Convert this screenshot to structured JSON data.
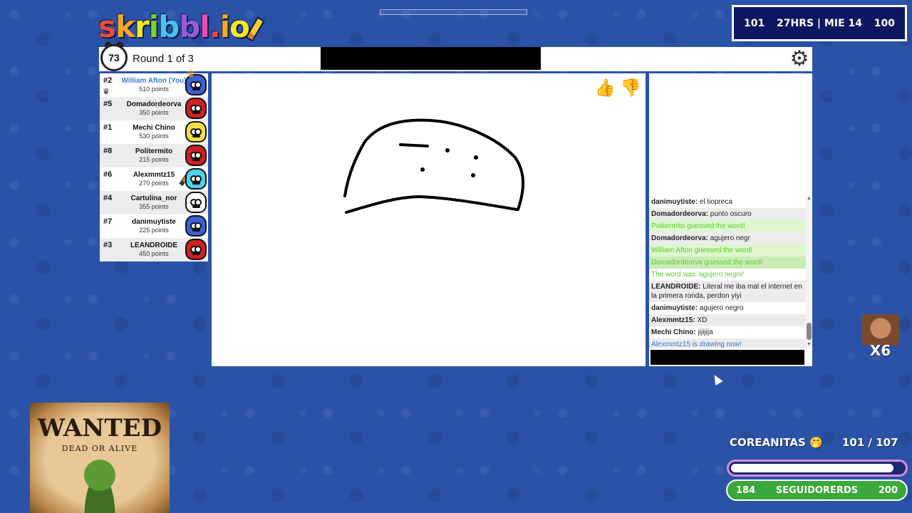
{
  "app": {
    "logo_text_1": "skribbl",
    "logo_text_2": ".io"
  },
  "colors": {
    "background": "#2a53a7",
    "guess_green": "#56ce27",
    "draw_blue": "#3975ce",
    "self_name_blue": "#3a7cd8"
  },
  "stream": {
    "left_value": "101",
    "center_text": "27HRS | MIE 14",
    "right_value": "100"
  },
  "header": {
    "timer": "73",
    "round_label": "Round 1 of 3",
    "settings_icon": "gear-icon"
  },
  "players": [
    {
      "rank": "#2",
      "name": "William Afton (You)",
      "points": "510 points",
      "color": "#3d5fd8",
      "self": true,
      "crown": true
    },
    {
      "rank": "#5",
      "name": "Domadordeorva",
      "points": "350 points",
      "color": "#d02020"
    },
    {
      "rank": "#1",
      "name": "Mechi Chino",
      "points": "530 points",
      "color": "#f5e048"
    },
    {
      "rank": "#8",
      "name": "Politermito",
      "points": "215 points",
      "color": "#d02020"
    },
    {
      "rank": "#6",
      "name": "Alexmmtz15",
      "points": "270 points",
      "color": "#4fd0e8",
      "drawing": true
    },
    {
      "rank": "#4",
      "name": "Cartulina_nor",
      "points": "355 points",
      "color": "#ffffff"
    },
    {
      "rank": "#7",
      "name": "danimuytiste",
      "points": "225 points",
      "color": "#3d5fd8"
    },
    {
      "rank": "#3",
      "name": "LEANDROIDE",
      "points": "450 points",
      "color": "#d02020"
    }
  ],
  "canvas": {
    "like_icon": "thumbs-up-icon",
    "dislike_icon": "thumbs-down-icon"
  },
  "chat": {
    "messages": [
      {
        "who": "danimuytiste",
        "text": "el tiopreca",
        "type": "normal"
      },
      {
        "who": "Domadordeorva",
        "text": "punto oscuro",
        "type": "normal"
      },
      {
        "who": "",
        "text": "Politermito guessed the word!",
        "type": "guess"
      },
      {
        "who": "Domadordeorva",
        "text": "agujero negr",
        "type": "normal"
      },
      {
        "who": "",
        "text": "William Afton guessed the word!",
        "type": "guess"
      },
      {
        "who": "",
        "text": "Domadordeorva guessed the word!",
        "type": "guess"
      },
      {
        "who": "",
        "text": "The word was 'agujero negro'",
        "type": "info"
      },
      {
        "who": "LEANDROIDE",
        "text": "Literal me iba mal el internet en la primera ronda, perdon yiyi",
        "type": "normal"
      },
      {
        "who": "danimuytiste",
        "text": "agujero negro",
        "type": "normal"
      },
      {
        "who": "Alexmmtz15",
        "text": "XD",
        "type": "normal"
      },
      {
        "who": "Mechi Chino",
        "text": "jijijija",
        "type": "normal"
      },
      {
        "who": "",
        "text": "Alexmmtz15 is drawing now!",
        "type": "draw"
      }
    ],
    "input_value": ""
  },
  "overlay": {
    "multiplier": "X6",
    "wanted_title": "WANTED",
    "wanted_subtitle": "DEAD OR ALIVE"
  },
  "goal": {
    "label": "COREANITAS 🤭",
    "count": "101  /  107",
    "progress": 0.944
  },
  "followers": {
    "start": "184",
    "label": "SEGUIDORERDS",
    "end": "200",
    "progress": 0.0
  }
}
